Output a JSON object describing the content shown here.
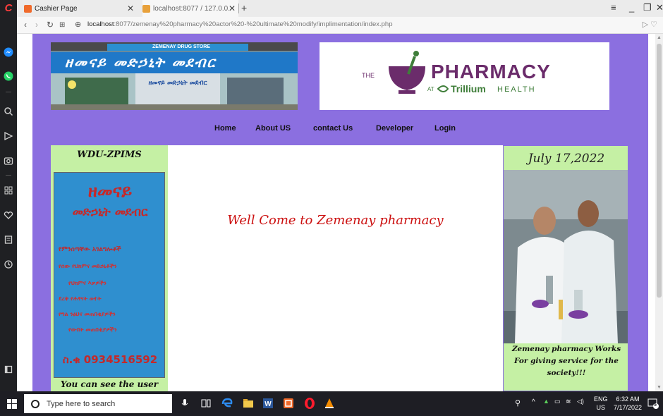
{
  "browser": {
    "tabs": [
      {
        "label": "Cashier Page",
        "active": true
      },
      {
        "label": "localhost:8077 / 127.0.0.1",
        "active": false
      }
    ],
    "url_host": "localhost",
    "url_rest": ":8077/zemenay%20pharmacy%20actor%20-%20ultimate%20modify/implimentation/index.php",
    "new_tab": "+"
  },
  "site": {
    "store_sign_amharic": "ዘመናይ መድኃኒት መደብር",
    "store_sign_english": "ZEMENAY DRUG STORE",
    "logo": {
      "the": "THE",
      "pharmacy": "PHARMACY",
      "at": "AT",
      "brand": "Trillium",
      "health": "HEALTH"
    },
    "nav": [
      "Home",
      "About US",
      "contact Us",
      "Developer",
      "Login"
    ],
    "left_title": "WDU-ZPIMS",
    "left_caption": "You can see the user",
    "poster": {
      "title1": "ዘመናይ",
      "title2": "መድኃኒት መደብር",
      "line1": "የምንሰጣቸው አገልግሎቶች",
      "line2": "የሰው የህክምና መድኃኒቶችን",
      "line3": "የህክምና እቃዎችን",
      "line4": "ደረቅ የሕፃናት ወተት",
      "line5": "የግል ንፅህና መጠበቂያዎችን",
      "line6": "የውበት መጠበቂያዎችን",
      "phone": "ስ.ቁ 0934516592"
    },
    "welcome": "Well Come to Zemenay pharmacy",
    "date": "July 17,2022",
    "right_text": "Zemenay pharmacy Works For giving service for the society!!!"
  },
  "taskbar": {
    "search_placeholder": "Type here to search",
    "lang": "ENG",
    "region": "US",
    "time": "6:32 AM",
    "date": "7/17/2022",
    "notification_count": "5"
  },
  "colors": {
    "page_bg": "#8b6fe0",
    "column_bg": "#c5f0a4",
    "welcome": "#cc1111",
    "logo_purple": "#6b2c6b",
    "logo_green": "#3f7e3a"
  }
}
